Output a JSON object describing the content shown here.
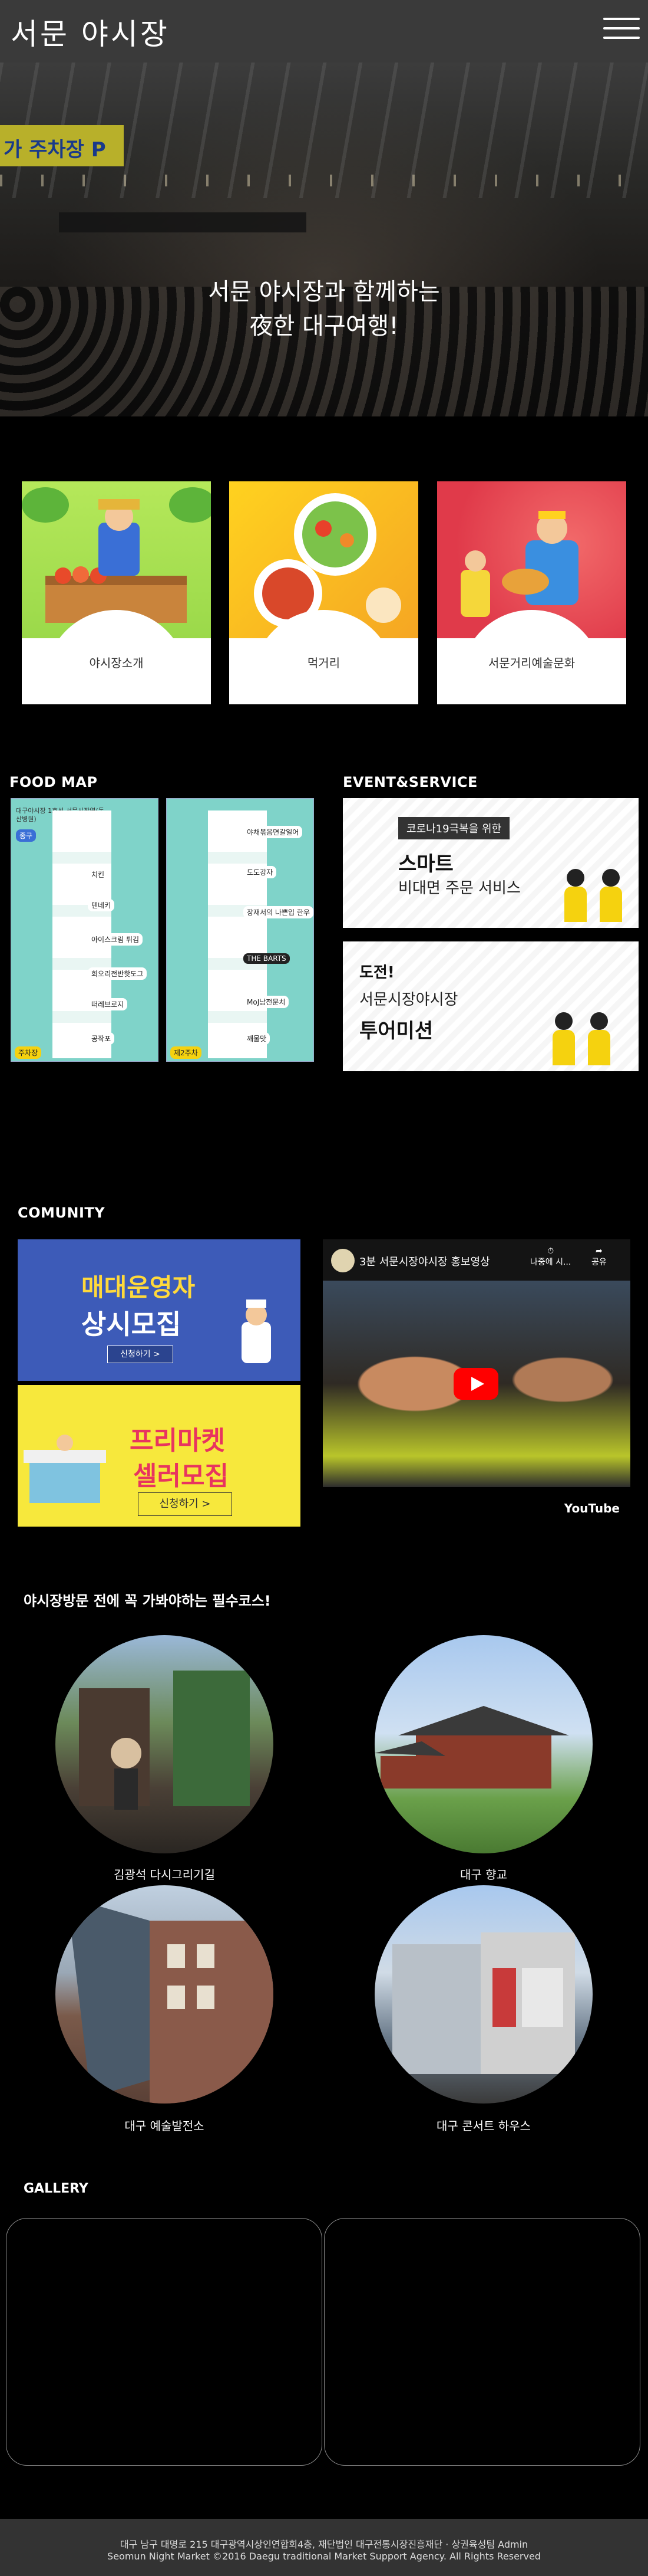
{
  "header": {
    "logo": "서문 야시장",
    "menu_icon": "hamburger-icon"
  },
  "hero": {
    "line1": "서문 야시장과 함께하는",
    "line2": "夜한 대구여행!",
    "sign_text": "가 주차장 P"
  },
  "categories": [
    {
      "label": "야시장소개"
    },
    {
      "label": "먹거리"
    },
    {
      "label": "서문거리예술문화"
    }
  ],
  "food_map": {
    "title": "FOOD MAP",
    "panel1_header": "대구야시장 1호선 서문시장역(동산병원)",
    "panel1_stop": "종구",
    "panel1_items": [
      "치킨",
      "텐네키",
      "아이스크림 튀김",
      "회오리전반핫도그",
      "떠레브로지",
      "공작포"
    ],
    "panel2_items": [
      "야채볶음면갈일어",
      "도도강자",
      "장재서의 나쁜입 한우",
      "THE BARTS",
      "MoJ남전문치",
      "깨물맛"
    ],
    "stop_label": "주차장",
    "stop_label2": "제2주차"
  },
  "event": {
    "title": "EVENT&SERVICE",
    "card1": {
      "tag": "코로나19극복을 위한",
      "big": "스마트",
      "sub": "비대면 주문 서비스"
    },
    "card2": {
      "small": "도전!",
      "mid": "서문시장야시장",
      "big": "투어미션"
    }
  },
  "community": {
    "title": "COMUNITY",
    "banner1": {
      "title1": "매대운영자",
      "title2": "상시모집",
      "button": "신청하기 >"
    },
    "banner2": {
      "title1": "프리마켓",
      "title2": "셀러모집",
      "button": "신청하기 >"
    },
    "video": {
      "title": "3분 서문시장야시장 홍보영상",
      "later": "나중에 시...",
      "share": "공유",
      "brand": "YouTube"
    }
  },
  "must_see": {
    "title": "야시장방문 전에 꼭 가봐야하는 필수코스!",
    "places": [
      {
        "label": "김광석 다시그리기길"
      },
      {
        "label": "대구 향교"
      },
      {
        "label": "대구 예술발전소"
      },
      {
        "label": "대구 콘서트 하우스"
      }
    ]
  },
  "gallery": {
    "title": "GALLERY"
  },
  "footer": {
    "line1": "대구 남구 대명로 215 대구광역시상인연합회4층, 재단법인 대구전통시장진흥재단 · 상권육성팀 Admin",
    "line2": "Seomun Night Market ©2016 Daegu traditional Market Support Agency. All Rights Reserved"
  }
}
